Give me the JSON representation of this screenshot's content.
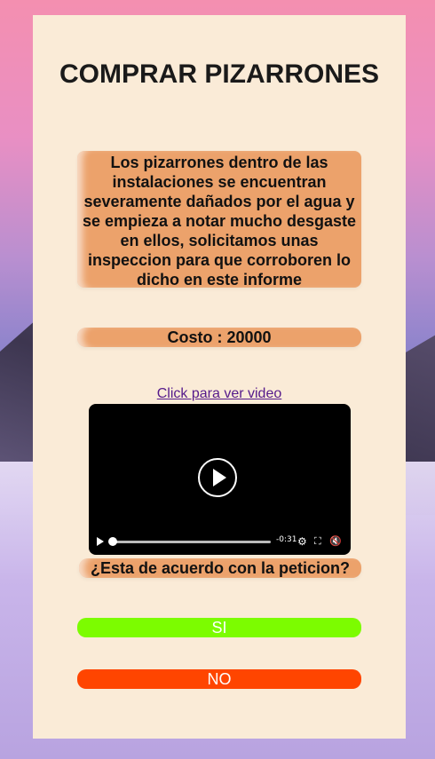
{
  "page": {
    "title": "COMPRAR PIZARRONES",
    "description": "Los pizarrones dentro de las instalaciones se encuentran severamente dañados por el agua y se empieza a notar mucho desgaste en ellos, solicitamos unas inspeccion para que corroboren lo dicho en este informe",
    "cost": "Costo : 20000",
    "video_link": "Click para ver video",
    "question": "¿Esta de acuerdo con la peticion?"
  },
  "video": {
    "time_remaining": "-0:31",
    "progress": 0.02,
    "icons": [
      "play-icon",
      "settings-icon",
      "fullscreen-icon",
      "mute-icon"
    ]
  },
  "buttons": {
    "yes_label": "SI",
    "no_label": "NO"
  },
  "colors": {
    "card_bg": "#faebd7",
    "pill_bg": "#eca26b",
    "yes_bg": "#7cfc00",
    "no_bg": "#ff4500",
    "link": "#551a8b"
  }
}
